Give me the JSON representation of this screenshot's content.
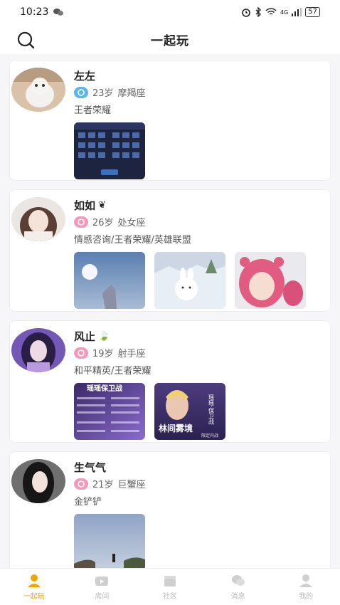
{
  "status": {
    "time": "10:23",
    "battery": "57",
    "network": "4G"
  },
  "header": {
    "title": "一起玩"
  },
  "users": [
    {
      "name": "左左",
      "emoji": "",
      "age": "23岁",
      "zodiac": "摩羯座",
      "badge_color": "#5ab7e8",
      "tags": "王者荣耀"
    },
    {
      "name": "如如",
      "emoji": "❦",
      "age": "26岁",
      "zodiac": "处女座",
      "badge_color": "#f49ab8",
      "tags": "情感咨询/王者荣耀/英雄联盟"
    },
    {
      "name": "风止",
      "emoji": "🍃",
      "age": "19岁",
      "zodiac": "射手座",
      "badge_color": "#f49ab8",
      "tags": "和平精英/王者荣耀"
    },
    {
      "name": "生气气",
      "emoji": "",
      "age": "21岁",
      "zodiac": "巨蟹座",
      "badge_color": "#f49ab8",
      "tags": "金铲铲"
    }
  ],
  "photo_text": {
    "p3a_title": "瑶瑶保卫战",
    "p3b_title": "林间雾境",
    "p3b_side": "瑶瑶·保卫战",
    "p3b_sub": "限定内战"
  },
  "tabs": [
    {
      "label": "一起玩",
      "icon": "person-icon",
      "active": true
    },
    {
      "label": "房间",
      "icon": "tv-icon"
    },
    {
      "label": "社区",
      "icon": "clapper-icon"
    },
    {
      "label": "消息",
      "icon": "chat-icon"
    },
    {
      "label": "我的",
      "icon": "user-icon"
    }
  ],
  "colors": {
    "accent": "#f0a500",
    "inactive": "#bbbbbb"
  }
}
